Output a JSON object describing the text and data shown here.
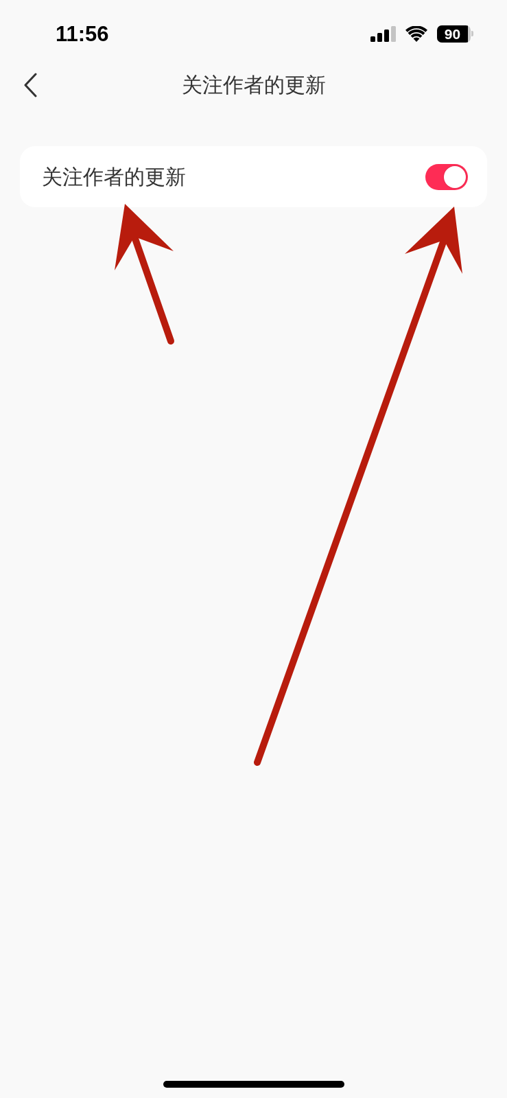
{
  "status_bar": {
    "time": "11:56",
    "battery": "90"
  },
  "nav_bar": {
    "title": "关注作者的更新"
  },
  "settings": [
    {
      "label": "关注作者的更新",
      "on": true
    }
  ]
}
